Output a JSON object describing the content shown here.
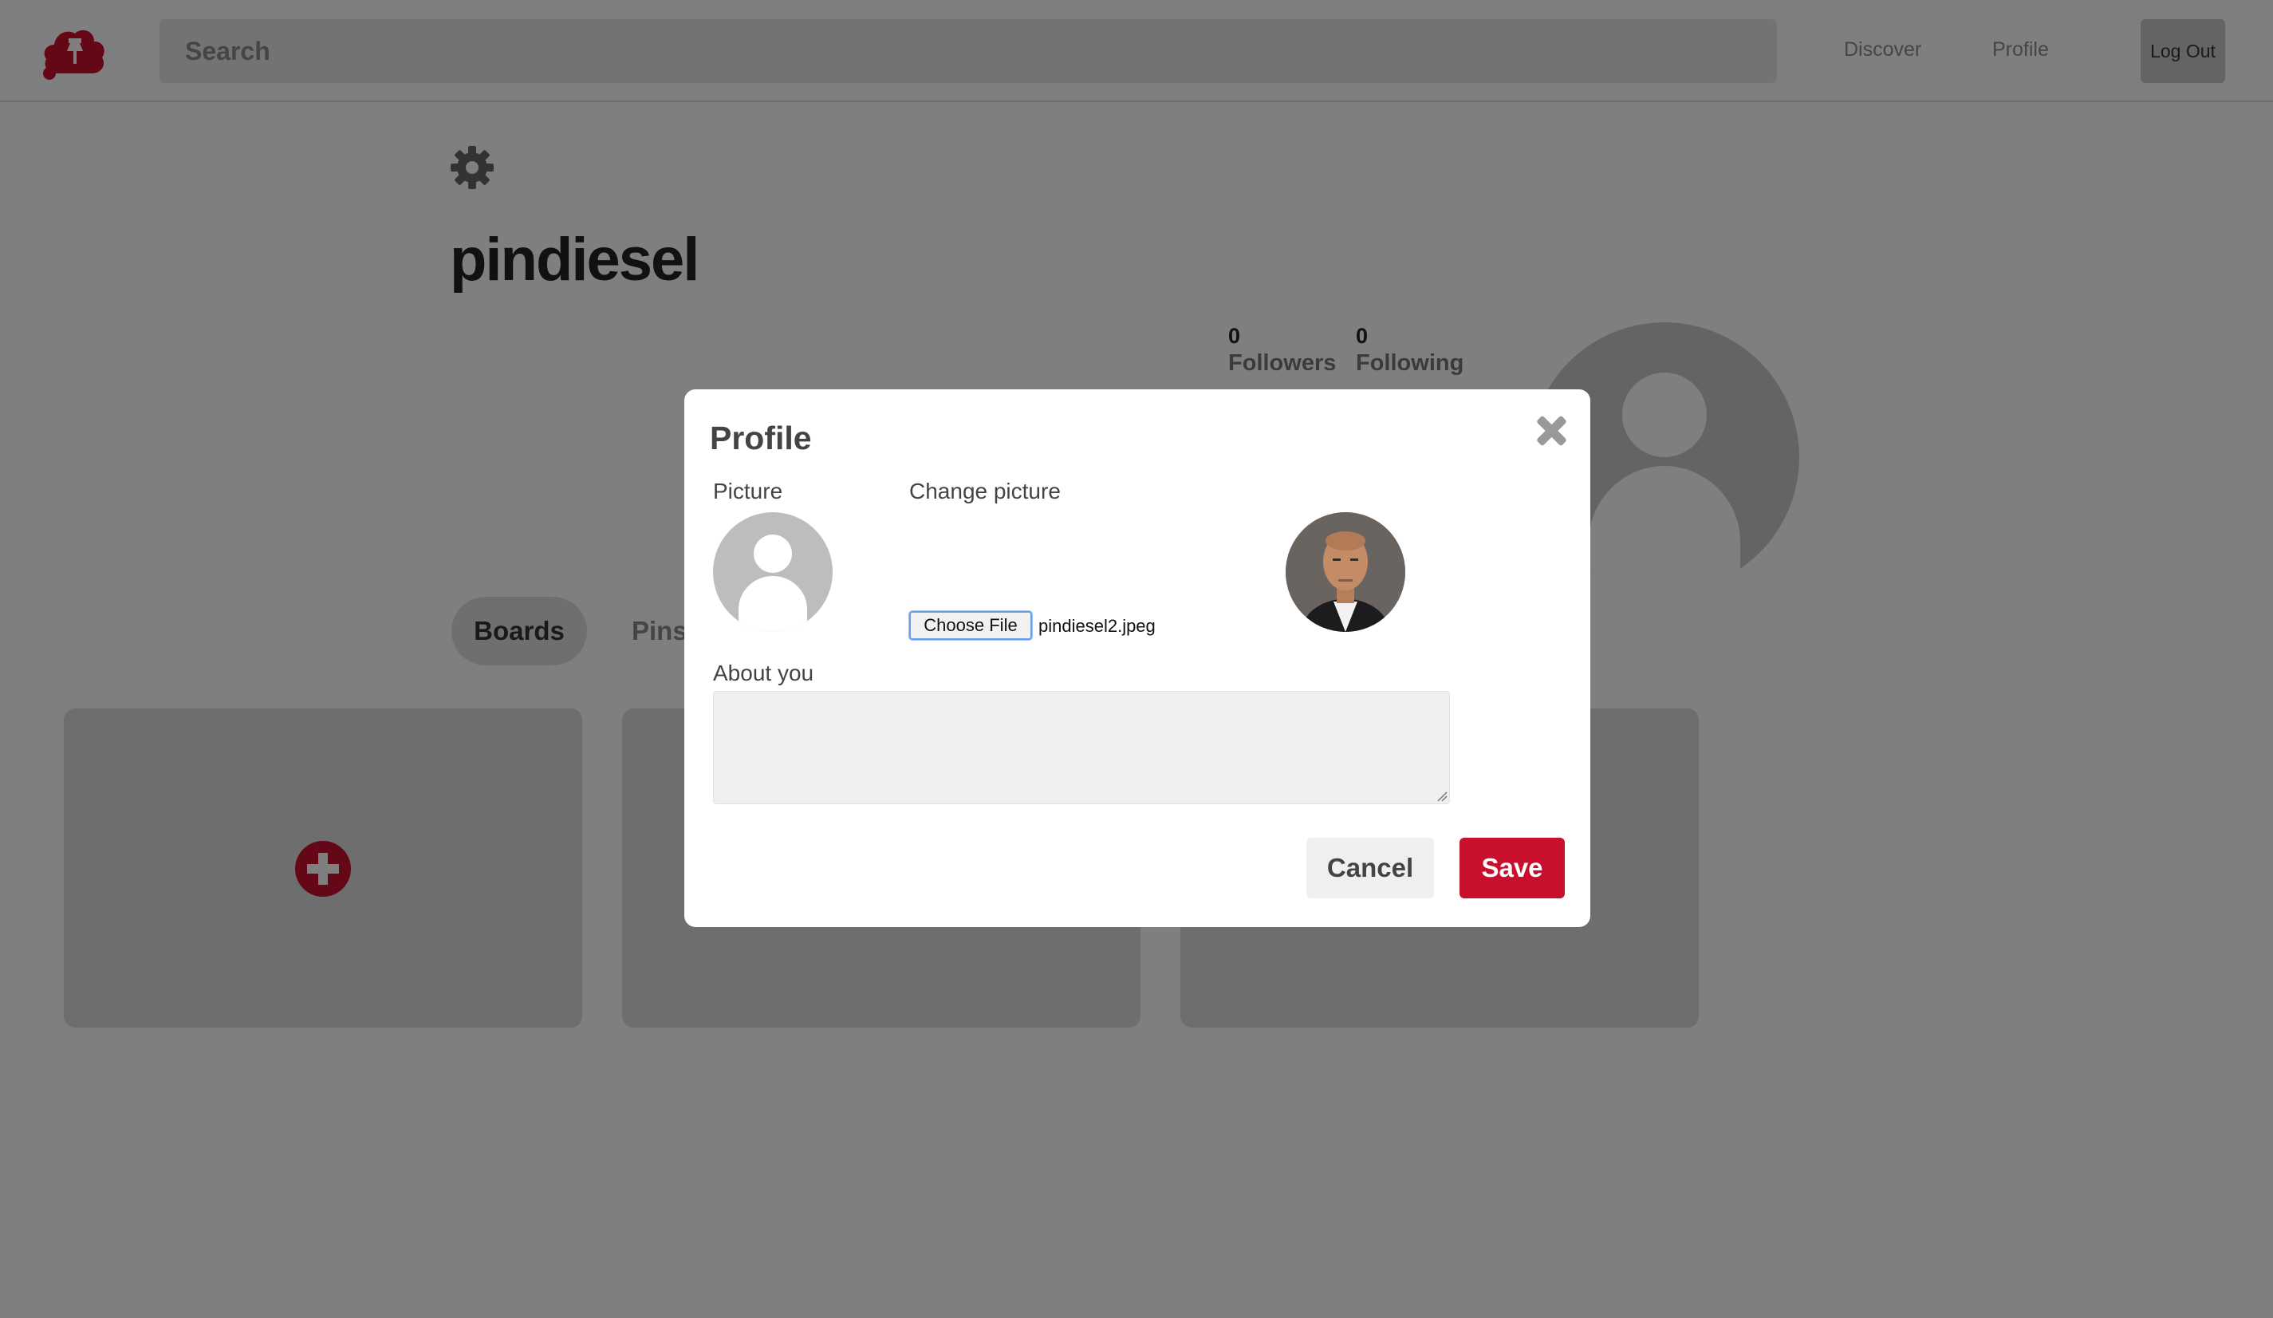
{
  "header": {
    "search_placeholder": "Search",
    "nav": {
      "discover": "Discover",
      "profile": "Profile"
    },
    "logout_label": "Log Out",
    "logo_icon": "pushpin-cloud-logo-icon"
  },
  "profile": {
    "username": "pindiesel",
    "followers_count": "0",
    "followers_label": "Followers",
    "following_count": "0",
    "following_label": "Following",
    "settings_icon": "gear-icon",
    "tabs": {
      "boards": "Boards",
      "pins": "Pins"
    },
    "add_board_icon": "plus-circle-icon"
  },
  "modal": {
    "title": "Profile",
    "picture_label": "Picture",
    "change_picture_label": "Change picture",
    "choose_file_label": "Choose File",
    "file_name": "pindiesel2.jpeg",
    "about_label": "About you",
    "about_value": "",
    "cancel_label": "Cancel",
    "save_label": "Save"
  },
  "colors": {
    "brand_red": "#c8102e",
    "overlay": "rgba(0,0,0,0.5)"
  }
}
